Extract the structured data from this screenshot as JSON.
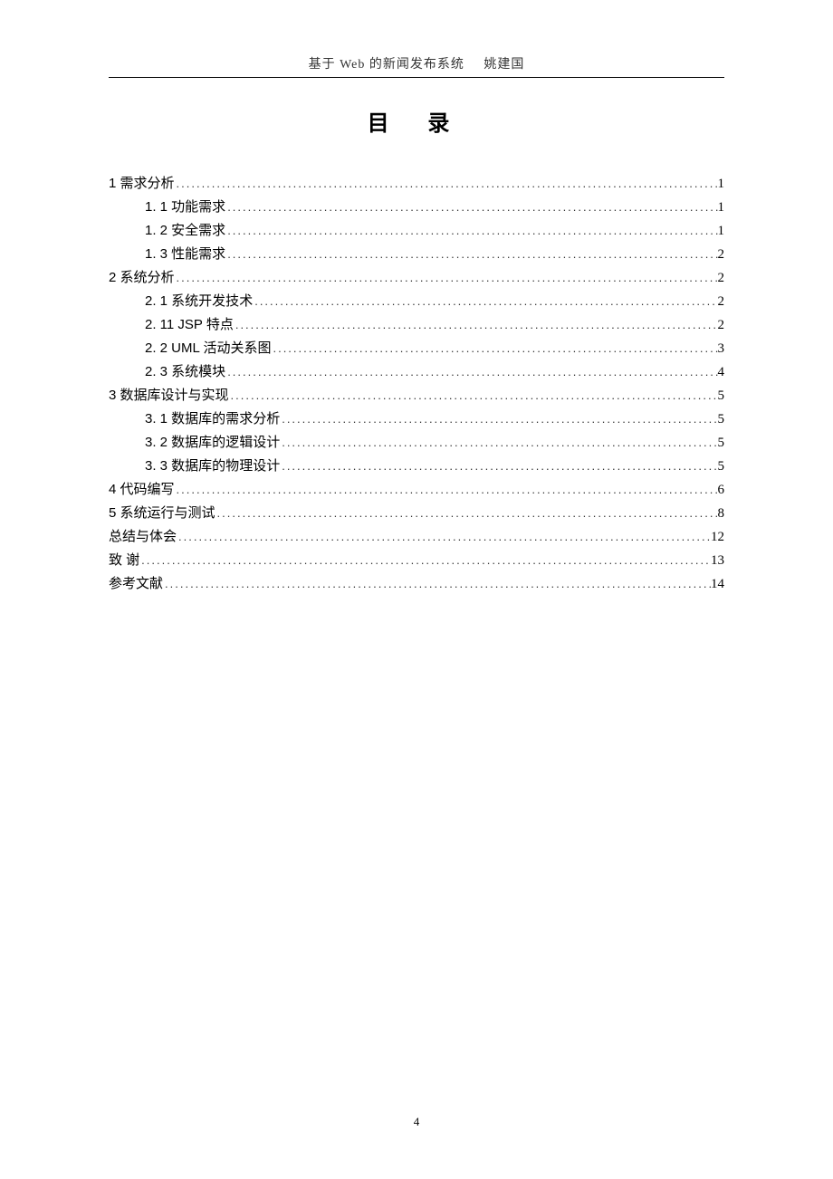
{
  "header": {
    "title_left": "基于 Web 的新闻发布系统",
    "title_right": "姚建国"
  },
  "toc_title": "目 录",
  "toc": [
    {
      "level": 0,
      "label": "1  需求分析",
      "page": "1"
    },
    {
      "level": 1,
      "label": "1. 1  功能需求",
      "page": "1"
    },
    {
      "level": 1,
      "label": "1. 2  安全需求",
      "page": "1"
    },
    {
      "level": 1,
      "label": "1. 3  性能需求",
      "page": "2"
    },
    {
      "level": 0,
      "label": "2  系统分析",
      "page": "2"
    },
    {
      "level": 1,
      "label": "2. 1  系统开发技术",
      "page": "2"
    },
    {
      "level": 1,
      "label": "2. 11  JSP 特点",
      "page": "2"
    },
    {
      "level": 1,
      "label": "2. 2  UML 活动关系图",
      "page": "3"
    },
    {
      "level": 1,
      "label": "2. 3  系统模块",
      "page": "4"
    },
    {
      "level": 0,
      "label": "3  数据库设计与实现",
      "page": "5"
    },
    {
      "level": 1,
      "label": "3. 1  数据库的需求分析",
      "page": "5"
    },
    {
      "level": 1,
      "label": "3. 2  数据库的逻辑设计",
      "page": "5"
    },
    {
      "level": 1,
      "label": "3. 3  数据库的物理设计",
      "page": "5"
    },
    {
      "level": 0,
      "label": "4  代码编写",
      "page": "6"
    },
    {
      "level": 0,
      "label": "5  系统运行与测试",
      "page": "8"
    },
    {
      "level": 0,
      "label": "总结与体会",
      "page": "12"
    },
    {
      "level": 0,
      "label": "致    谢",
      "page": "13"
    },
    {
      "level": 0,
      "label": "参考文献",
      "page": "14"
    }
  ],
  "page_number": "4"
}
